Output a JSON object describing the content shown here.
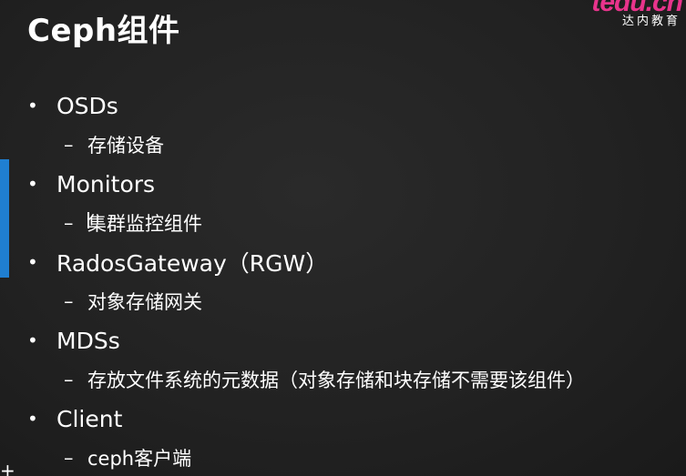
{
  "slide": {
    "title": "Ceph组件",
    "logo": {
      "mark": "tedu.cn",
      "sub": "达内教育"
    },
    "bullet_glyph": "•",
    "dash_glyph": "–",
    "items": [
      {
        "label": "OSDs",
        "sub": "存储设备"
      },
      {
        "label": "Monitors",
        "sub": "集群监控组件"
      },
      {
        "label": "RadosGateway（RGW）",
        "sub": "对象存储网关"
      },
      {
        "label": "MDSs",
        "sub": "存放文件系统的元数据（对象存储和块存储不需要该组件）"
      },
      {
        "label": "Client",
        "sub": "ceph客户端"
      }
    ],
    "corner_symbol": "+"
  },
  "colors": {
    "background": "#222222",
    "text": "#ffffff",
    "accent_bar": "#1f7fd1",
    "logo": "#e8348c"
  }
}
